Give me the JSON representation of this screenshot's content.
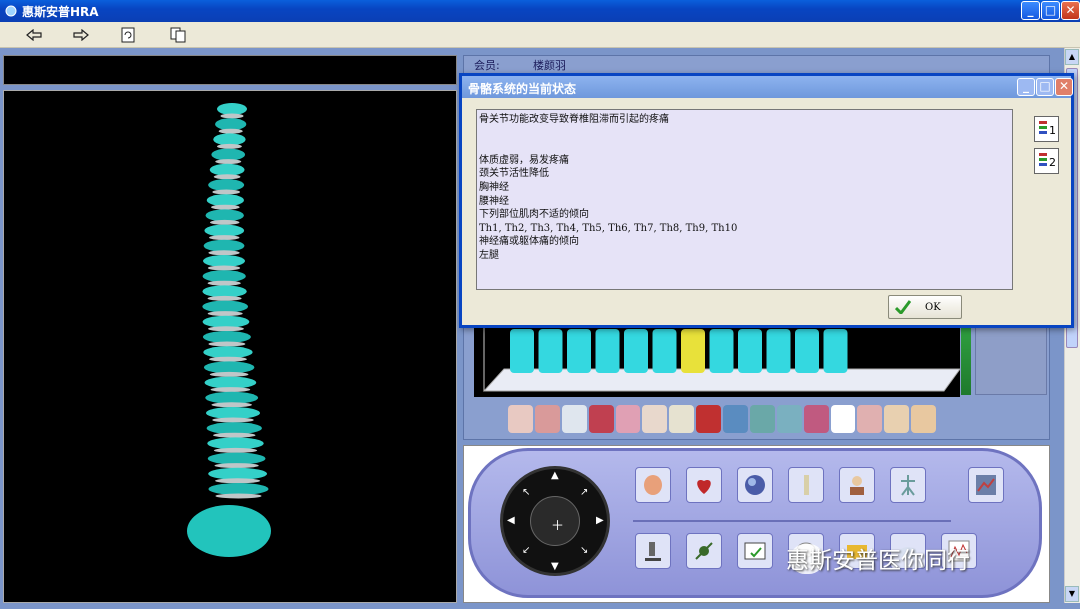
{
  "window": {
    "title": "惠斯安普HRA",
    "min_label": "_",
    "max_label": "□",
    "close_label": "✕"
  },
  "toolbar": {
    "back_icon": "back-arrow-icon",
    "forward_icon": "forward-arrow-icon",
    "refresh_icon": "refresh-icon",
    "copy_icon": "copy-icon"
  },
  "member": {
    "label": "会员:",
    "value": "楼颜羽"
  },
  "dialog": {
    "title": "骨骼系统的当前状态",
    "lines": [
      "骨关节功能改变导致脊椎阻滞而引起的疼痛",
      "",
      "",
      "体质虚弱，易发疼痛",
      "颈关节活性降低",
      "胸神经",
      "腰神经",
      "下列部位肌肉不适的倾向",
      "Th1, Th2, Th3, Th4, Th5, Th6, Th7, Th8, Th9, Th10",
      "神经痛或躯体痛的倾向",
      "左腿"
    ],
    "ok_label": "OK",
    "side_buttons": [
      "1",
      "2"
    ]
  },
  "watermark": {
    "text": "惠斯安普医你同行"
  },
  "chart_data": {
    "type": "bar",
    "bars": 12,
    "highlight_index": 6,
    "colors": {
      "normal": "#34D8E0",
      "highlight": "#E8E13A"
    }
  }
}
